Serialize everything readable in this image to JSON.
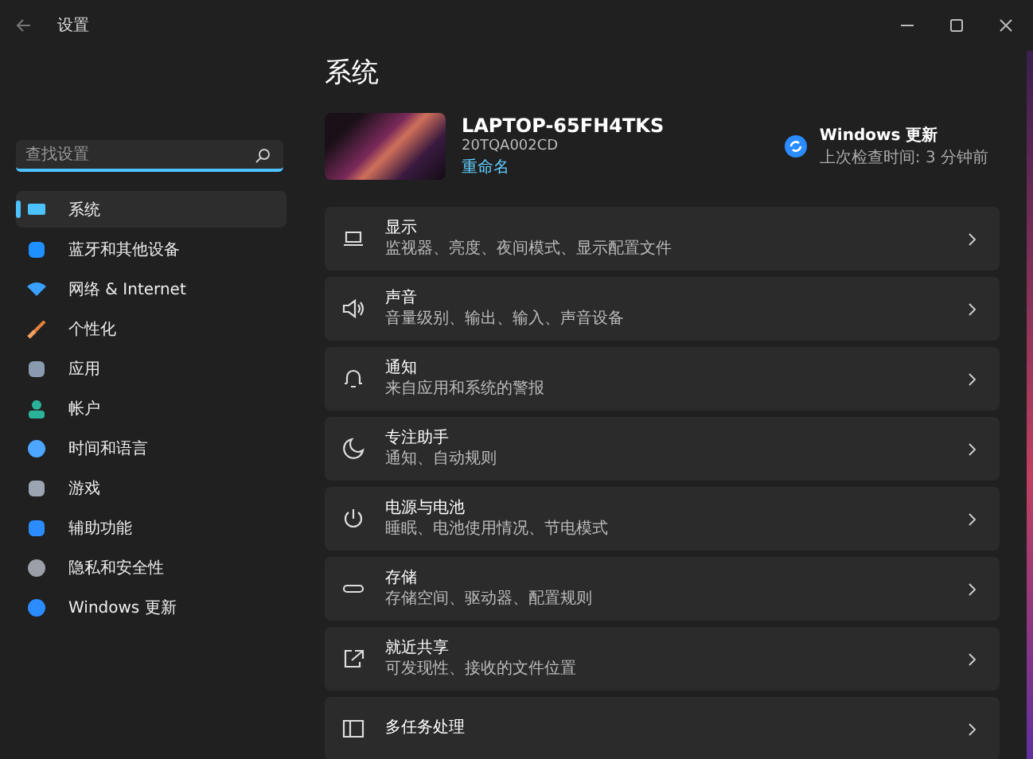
{
  "window": {
    "title": "设置"
  },
  "sidebar": {
    "search": {
      "placeholder": "查找设置"
    },
    "items": [
      {
        "label": "系统",
        "selected": true
      },
      {
        "label": "蓝牙和其他设备",
        "selected": false
      },
      {
        "label": "网络 & Internet",
        "selected": false
      },
      {
        "label": "个性化",
        "selected": false
      },
      {
        "label": "应用",
        "selected": false
      },
      {
        "label": "帐户",
        "selected": false
      },
      {
        "label": "时间和语言",
        "selected": false
      },
      {
        "label": "游戏",
        "selected": false
      },
      {
        "label": "辅助功能",
        "selected": false
      },
      {
        "label": "隐私和安全性",
        "selected": false
      },
      {
        "label": "Windows 更新",
        "selected": false
      }
    ]
  },
  "page": {
    "title": "系统",
    "device": {
      "name": "LAPTOP-65FH4TKS",
      "model": "20TQA002CD",
      "rename": "重命名"
    },
    "update": {
      "title": "Windows 更新",
      "subtitle": "上次检查时间: 3 分钟前"
    },
    "cards": [
      {
        "title": "显示",
        "subtitle": "监视器、亮度、夜间模式、显示配置文件"
      },
      {
        "title": "声音",
        "subtitle": "音量级别、输出、输入、声音设备"
      },
      {
        "title": "通知",
        "subtitle": "来自应用和系统的警报"
      },
      {
        "title": "专注助手",
        "subtitle": "通知、自动规则"
      },
      {
        "title": "电源与电池",
        "subtitle": "睡眠、电池使用情况、节电模式"
      },
      {
        "title": "存储",
        "subtitle": "存储空间、驱动器、配置规则"
      },
      {
        "title": "就近共享",
        "subtitle": "可发现性、接收的文件位置"
      },
      {
        "title": "多任务处理"
      }
    ]
  }
}
